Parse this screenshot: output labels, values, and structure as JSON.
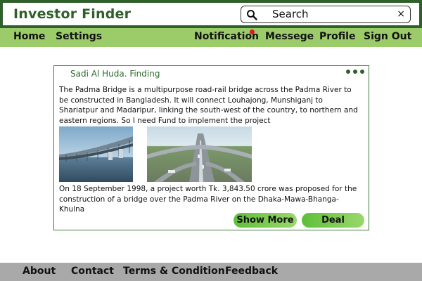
{
  "header": {
    "app_title": "Investor Finder",
    "search": {
      "text": "Search",
      "clear_symbol": "×"
    }
  },
  "nav": {
    "home": "Home",
    "settings": "Settings",
    "notification": "Notification",
    "message": "Messege",
    "profile": "Profile",
    "sign_out": "Sign Out"
  },
  "post": {
    "author": "Sadi Al Huda. Finding",
    "description": "The Padma Bridge is a multipurpose road-rail bridge across the Padma River to be constructed in Bangladesh. It will connect Louhajong, Munshiganj to Shariatpur and Madaripur, linking the south-west of the country, to northern and eastern regions. So I need Fund to implement the project",
    "note": "On 18 September 1998, a project worth Tk. 3,843.50 crore was proposed for the construction of a bridge over the Padma River on the Dhaka-Mawa-Bhanga-Khulna",
    "show_more_label": "Show More",
    "deal_label": "Deal"
  },
  "footer": {
    "about": "About",
    "contact": "Contact",
    "terms": "Terms & Condition",
    "feedback": "Feedback"
  },
  "colors": {
    "brand_green": "#2f5f2a",
    "nav_green": "#9ccb6a",
    "button_green": "#5fbf38",
    "notification_dot": "#d81e1e",
    "footer_gray": "#a9a9a9"
  }
}
